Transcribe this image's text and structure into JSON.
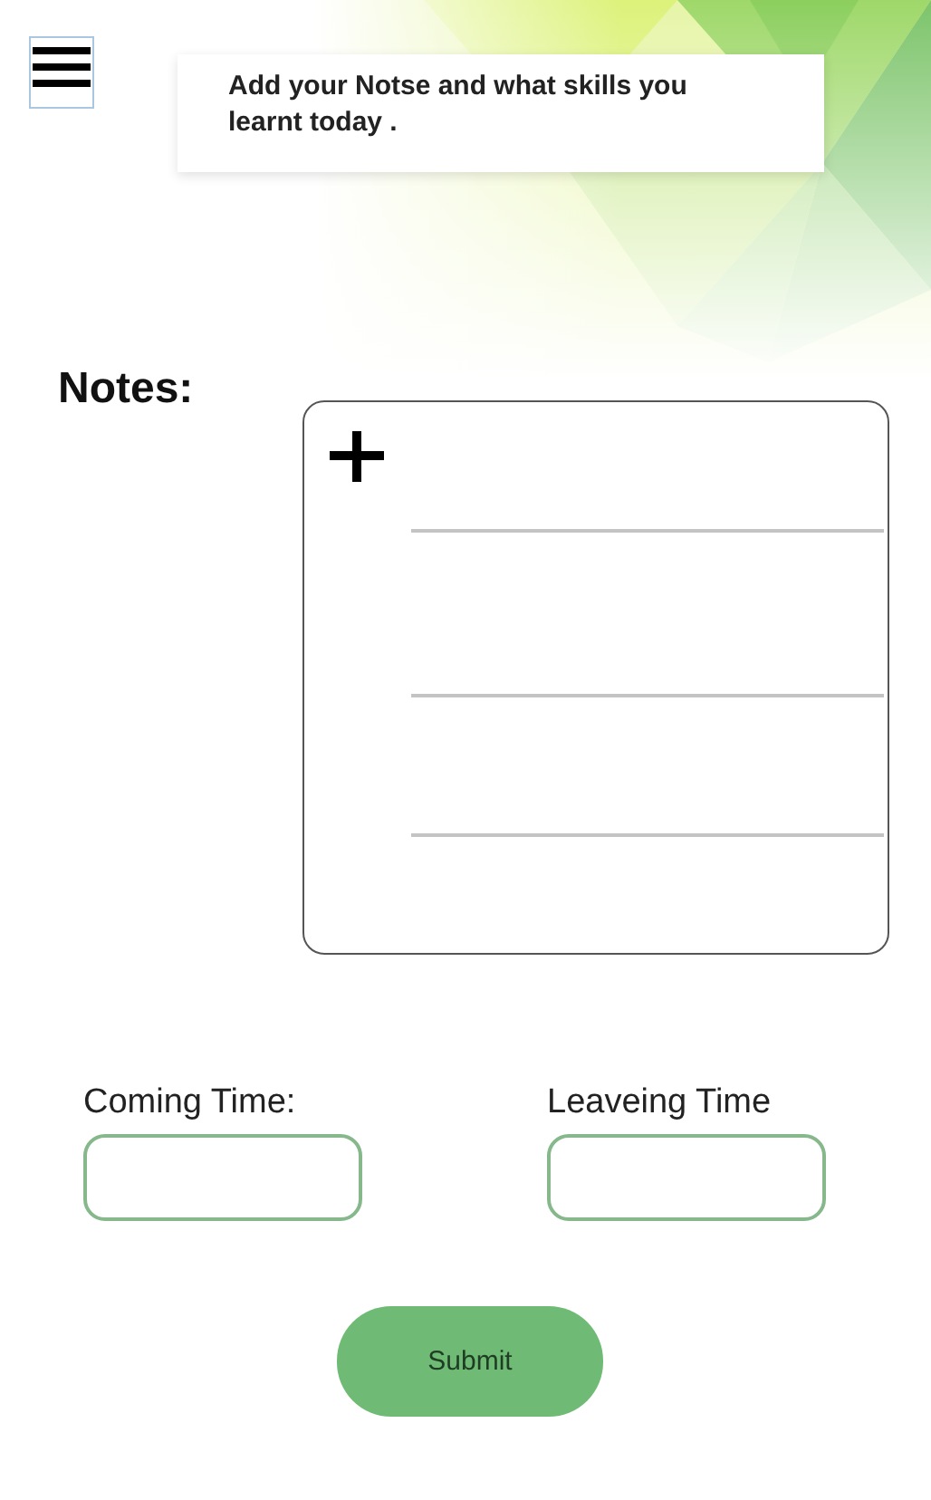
{
  "banner": {
    "text": "Add your Notse and what skills you learnt today ."
  },
  "notes": {
    "label": "Notes:"
  },
  "time_fields": [
    {
      "label": "Coming Time:"
    },
    {
      "label": "Leaveing Time"
    }
  ],
  "submit": {
    "label": "Submit"
  }
}
